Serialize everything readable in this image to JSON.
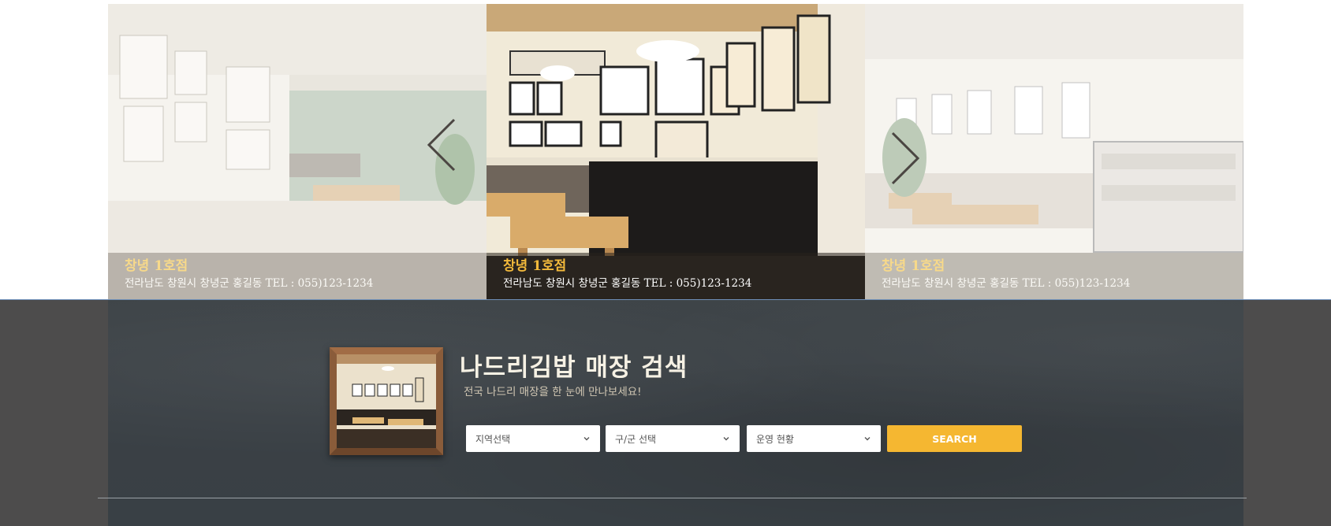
{
  "slider": {
    "slides": [
      {
        "title": "창녕 1호점",
        "address": "전라남도 창원시 창녕군 홍길동 TEL : 055)123-1234"
      },
      {
        "title": "창녕 1호점",
        "address": "전라남도 창원시 창녕군 홍길동 TEL : 055)123-1234"
      },
      {
        "title": "창녕 1호점",
        "address": "전라남도 창원시 창녕군 홍길동 TEL : 055)123-1234"
      }
    ],
    "prev_icon": "chevron-left-icon",
    "next_icon": "chevron-right-icon"
  },
  "store_search": {
    "title": "나드리김밥 매장 검색",
    "subtitle": "전국 나드리 매장을 한 눈에 만나보세요!",
    "region_select": "지역선택",
    "district_select": "구/군 선택",
    "status_select": "운영 현황",
    "search_button": "SEARCH",
    "accent_color": "#f5b731"
  }
}
